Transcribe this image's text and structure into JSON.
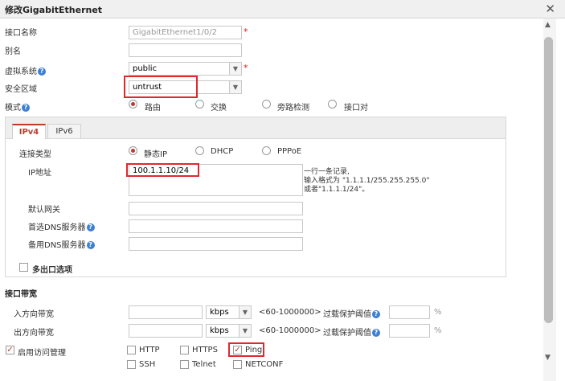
{
  "dialog": {
    "title": "修改GigabitEthernet",
    "close": "✕"
  },
  "form": {
    "if_name_label": "接口名称",
    "if_name_value": "GigabitEthernet1/0/2",
    "alias_label": "别名",
    "alias_value": "",
    "vsys_label": "虚拟系统",
    "vsys_value": "public",
    "zone_label": "安全区域",
    "zone_value": "untrust",
    "mode_label": "模式",
    "mode_options": [
      "路由",
      "交换",
      "旁路检测",
      "接口对"
    ],
    "mode_selected": "路由"
  },
  "ipv4": {
    "tabs": [
      "IPv4",
      "IPv6"
    ],
    "conn_type_label": "连接类型",
    "conn_options": [
      "静态IP",
      "DHCP",
      "PPPoE"
    ],
    "ip_label": "IP地址",
    "ip_value": "100.1.1.10/24",
    "ip_hint_1": "一行一条记录,",
    "ip_hint_2": "输入格式为 \"1.1.1.1/255.255.255.0\"",
    "ip_hint_3": "或者\"1.1.1.1/24\"。",
    "gateway_label": "默认网关",
    "dns1_label": "首选DNS服务器",
    "dns2_label": "备用DNS服务器",
    "multi_egress_label": "多出口选项"
  },
  "bandwidth": {
    "section_title": "接口带宽",
    "in_label": "入方向带宽",
    "out_label": "出方向带宽",
    "unit": "kbps",
    "range": "<60-1000000>",
    "overload_label": "过载保护阈值",
    "percent": "%"
  },
  "access": {
    "enable_label": "启用访问管理",
    "options": [
      "HTTP",
      "HTTPS",
      "Ping",
      "SSH",
      "Telnet",
      "NETCONF"
    ]
  },
  "icons": {
    "help": "?",
    "arrow": "▼",
    "check": "✓",
    "sb_up": "▲",
    "sb_down": "▼"
  }
}
